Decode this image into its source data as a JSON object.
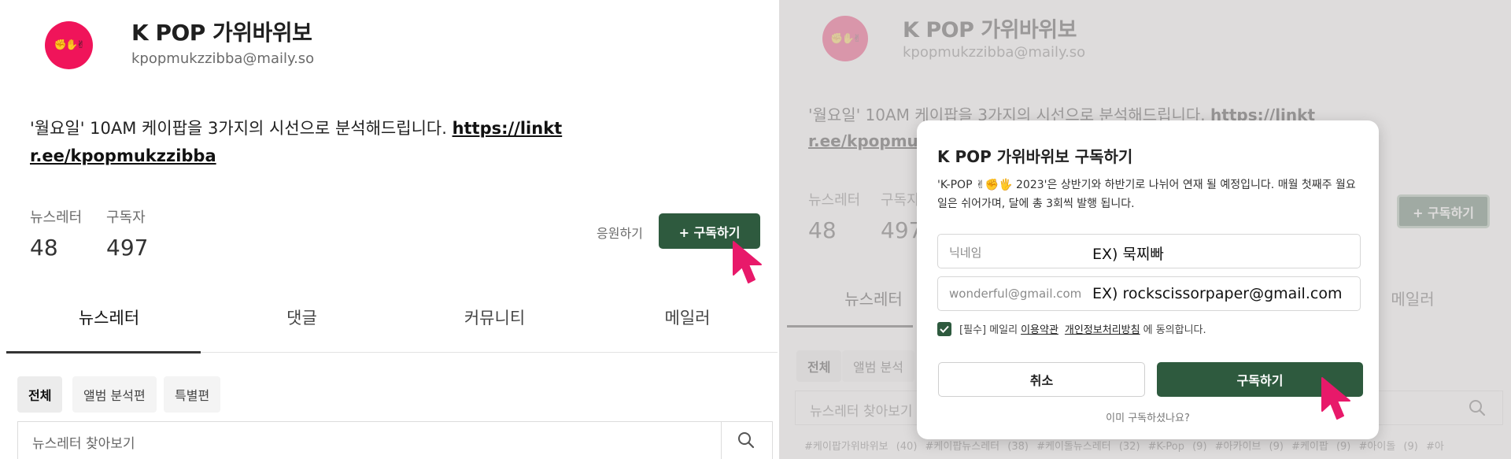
{
  "colors": {
    "accent_green": "#2e5a3e",
    "avatar_pink": "#f0145a",
    "cursor_pink": "#e8196a"
  },
  "left": {
    "avatar_icon": "rock-paper-scissors-hands-icon",
    "title": "K POP 가위바위보",
    "email": "kpopmukzzibba@maily.so",
    "description": "'월요일' 10AM 케이팝을 3가지의 시선으로 분석해드립니다. ",
    "link_part1": "https://linkt",
    "link_part2": "r.ee/kpopmukzzibba",
    "stats": [
      {
        "label": "뉴스레터",
        "value": "48"
      },
      {
        "label": "구독자",
        "value": "497"
      }
    ],
    "support_label": "응원하기",
    "subscribe_label": "+ 구독하기",
    "tabs": [
      "뉴스레터",
      "댓글",
      "커뮤니티",
      "메일러"
    ],
    "chips": [
      "전체",
      "앨범 분석편",
      "특별편"
    ],
    "search_placeholder": "뉴스레터 찾아보기"
  },
  "right": {
    "title": "K POP 가위바위보",
    "email": "kpopmukzzibba@maily.so",
    "description": "'월요일' 10AM 케이팝을 3가지의 시선으로 분석해드립니다. ",
    "link_part1": "https://linkt",
    "link_part2": "r.ee/kpopmuk",
    "stats": [
      {
        "label": "뉴스레터",
        "value": "48"
      },
      {
        "label": "구독자",
        "value": "497"
      }
    ],
    "subscribe_label": "+ 구독하기",
    "tabs": [
      "뉴스레터",
      "메일러"
    ],
    "chips": [
      "전체",
      "앨범 분석"
    ],
    "search_placeholder": "뉴스레터 찾아보기",
    "hashtags": "#케이팝가위바위보 (40)  #케이팝뉴스레터 (38)  #케이돌뉴스레터 (32)  #K-Pop (9)  #아카이브 (9)  #케이팝 (9)  #아이돌 (9)  #아"
  },
  "modal": {
    "title": "K POP 가위바위보 구독하기",
    "description": "'K-POP ✌✊🖐 2023'은 상반기와 하반기로 나뉘어 연재 될 예정입니다. 매월 첫째주 월요일은 쉬어가며, 달에 총 3회씩 발행 됩니다.",
    "nickname_placeholder": "닉네임",
    "nickname_example": "EX) 묵찌빠",
    "email_placeholder": "wonderful@gmail.com",
    "email_example": "EX) rockscissorpaper@gmail.com",
    "agree_prefix": "[필수] 메일리",
    "agree_terms": "이용약관",
    "agree_privacy": "개인정보처리방침",
    "agree_suffix": "에 동의합니다.",
    "agree_checked": true,
    "cancel_label": "취소",
    "confirm_label": "구독하기",
    "already_label": "이미 구독하셨나요?"
  }
}
